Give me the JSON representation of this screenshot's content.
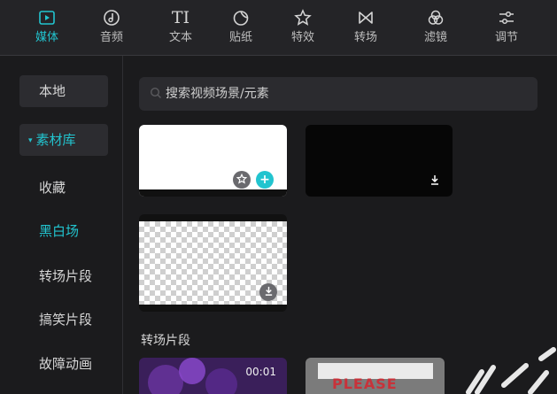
{
  "tabs": [
    {
      "label": "媒体",
      "icon": "media-play-icon",
      "active": true
    },
    {
      "label": "音频",
      "icon": "music-note-icon",
      "active": false
    },
    {
      "label": "文本",
      "icon": "text-icon",
      "active": false
    },
    {
      "label": "贴纸",
      "icon": "sticker-icon",
      "active": false
    },
    {
      "label": "特效",
      "icon": "effects-star-icon",
      "active": false
    },
    {
      "label": "转场",
      "icon": "transition-bowtie-icon",
      "active": false
    },
    {
      "label": "滤镜",
      "icon": "filter-circles-icon",
      "active": false
    },
    {
      "label": "调节",
      "icon": "adjust-sliders-icon",
      "active": false
    }
  ],
  "tab_text_icon": "TI",
  "sidebar": {
    "items": [
      {
        "label": "本地"
      },
      {
        "label": "素材库"
      },
      {
        "label": "收藏"
      },
      {
        "label": "黑白场"
      },
      {
        "label": "转场片段"
      },
      {
        "label": "搞笑片段"
      },
      {
        "label": "故障动画"
      }
    ],
    "caret": "▾"
  },
  "search": {
    "placeholder": "搜索视频场景/元素"
  },
  "section": {
    "title": "转场片段"
  },
  "clips": [
    {
      "time": "00:01"
    },
    {
      "caption": "PLEASE"
    }
  ],
  "colors": {
    "accent": "#22c4cf",
    "background": "#1b1b1d"
  }
}
